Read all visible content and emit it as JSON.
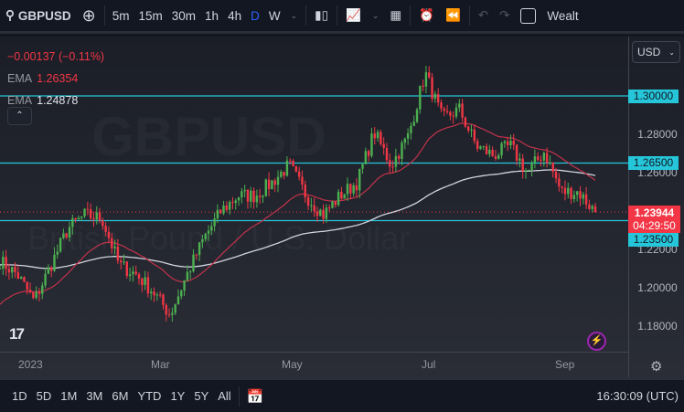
{
  "toolbar": {
    "symbol": "GBPUSD",
    "intervals": [
      "5m",
      "15m",
      "30m",
      "1h",
      "4h",
      "D",
      "W"
    ],
    "active_interval": "D",
    "watchlist_label": "Wealt"
  },
  "legend": {
    "change": "−0.00137 (−0.11%)",
    "ema1_label": "EMA",
    "ema1_value": "1.26354",
    "ema2_label": "EMA",
    "ema2_value": "1.24878"
  },
  "watermark": {
    "symbol": "GBPUSD",
    "name": "British Pound / U.S. Dollar"
  },
  "currency": "USD",
  "price_scale": {
    "ticks": [
      "1.28000",
      "1.26000",
      "1.22000",
      "1.20000",
      "1.18000"
    ],
    "levels": [
      "1.30000",
      "1.26500",
      "1.23500"
    ],
    "last_price": "1.23944",
    "countdown": "04:29:50"
  },
  "time_axis": [
    "2023",
    "Mar",
    "May",
    "Jul",
    "Sep"
  ],
  "ranges": [
    "1D",
    "5D",
    "1M",
    "3M",
    "6M",
    "YTD",
    "1Y",
    "5Y",
    "All"
  ],
  "clock": "16:30:09 (UTC)",
  "colors": {
    "up": "#4caf50",
    "down": "#f23645",
    "level": "#26c6da",
    "ema_fast": "#c2334a",
    "ema_slow": "#d1d4dc"
  },
  "chart_data": {
    "type": "candlestick",
    "ylim": [
      1.17,
      1.332
    ],
    "price_path": [
      1.214,
      1.207,
      1.193,
      1.212,
      1.231,
      1.238,
      1.236,
      1.212,
      1.207,
      1.198,
      1.186,
      1.207,
      1.226,
      1.24,
      1.248,
      1.248,
      1.255,
      1.264,
      1.248,
      1.238,
      1.248,
      1.255,
      1.281,
      1.264,
      1.279,
      1.312,
      1.288,
      1.293,
      1.274,
      1.269,
      1.274,
      1.26,
      1.271,
      1.25,
      1.25,
      1.2394
    ],
    "levels": [
      1.3,
      1.265,
      1.235
    ],
    "last": 1.23944,
    "ema_fast_last": 1.26354,
    "ema_slow_last": 1.24878
  }
}
